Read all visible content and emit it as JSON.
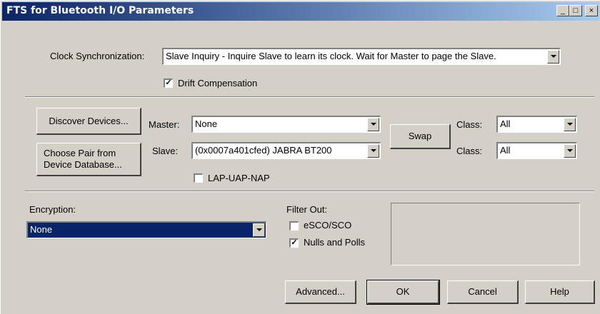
{
  "window": {
    "title": "FTS for Bluetooth I/O Parameters",
    "controls": {
      "minimize": "_",
      "maximize": "□",
      "close": "×"
    }
  },
  "clock": {
    "label": "Clock Synchronization:",
    "value": "Slave Inquiry - Inquire Slave to learn its clock. Wait for Master to page the Slave.",
    "drift_label": "Drift Compensation",
    "drift_checked": true
  },
  "devices": {
    "discover_label": "Discover Devices...",
    "choose_pair_label": "Choose Pair from Device Database...",
    "master_label": "Master:",
    "master_value": "None",
    "slave_label": "Slave:",
    "slave_value": "(0x0007a401cfed) JABRA BT200",
    "swap_label": "Swap",
    "class_label_1": "Class:",
    "class_value_1": "All",
    "class_label_2": "Class:",
    "class_value_2": "All",
    "lap_label": "LAP-UAP-NAP",
    "lap_checked": false
  },
  "encryption": {
    "label": "Encryption:",
    "value": "None"
  },
  "filter": {
    "label": "Filter Out:",
    "esco_label": "eSCO/SCO",
    "esco_checked": false,
    "nulls_label": "Nulls and Polls",
    "nulls_checked": true
  },
  "footer": {
    "advanced_label": "Advanced...",
    "ok_label": "OK",
    "cancel_label": "Cancel",
    "help_label": "Help"
  }
}
